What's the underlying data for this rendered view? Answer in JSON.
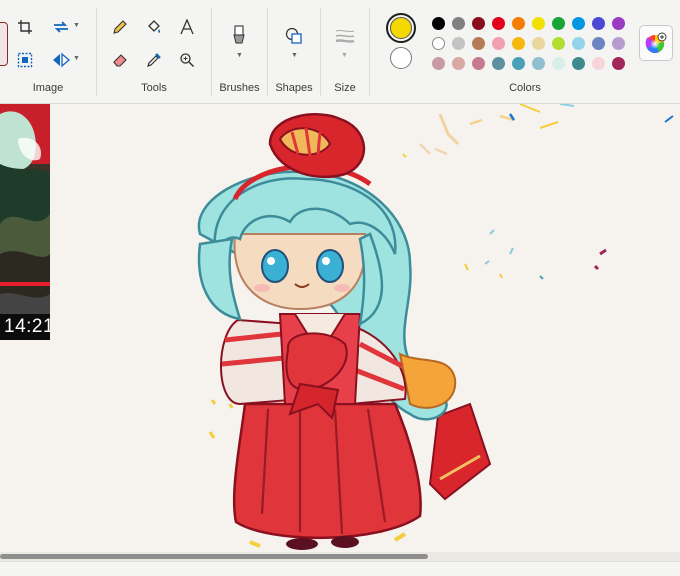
{
  "ribbon": {
    "image_label": "Image",
    "tools_label": "Tools",
    "brushes_label": "Brushes",
    "shapes_label": "Shapes",
    "size_label": "Size",
    "colors_label": "Colors"
  },
  "colors": {
    "color1": "#f5d800",
    "color2": "#ffffff",
    "palette": [
      [
        "#000000",
        "#808080",
        "#8b0f1a",
        "#e3001b",
        "#f57c00",
        "#f1e000",
        "#17a535",
        "#0097e0",
        "#4b48d6",
        "#9b3bc2"
      ],
      [
        "#ffffff",
        "#c3c3c3",
        "#b57b56",
        "#f39fb2",
        "#f6b80b",
        "#ead7a0",
        "#b2dd31",
        "#93d5e8",
        "#6b85c2",
        "#b99ccf"
      ],
      [
        "#c89aa6",
        "#d8a8a3",
        "#c87a8c",
        "#5d8fa0",
        "#4aa0b8",
        "#8fbfd0",
        "#d8efe8",
        "#3f8a8c",
        "#f5d5d8",
        "#a3265a"
      ]
    ]
  },
  "video": {
    "timestamp": "14:21"
  }
}
